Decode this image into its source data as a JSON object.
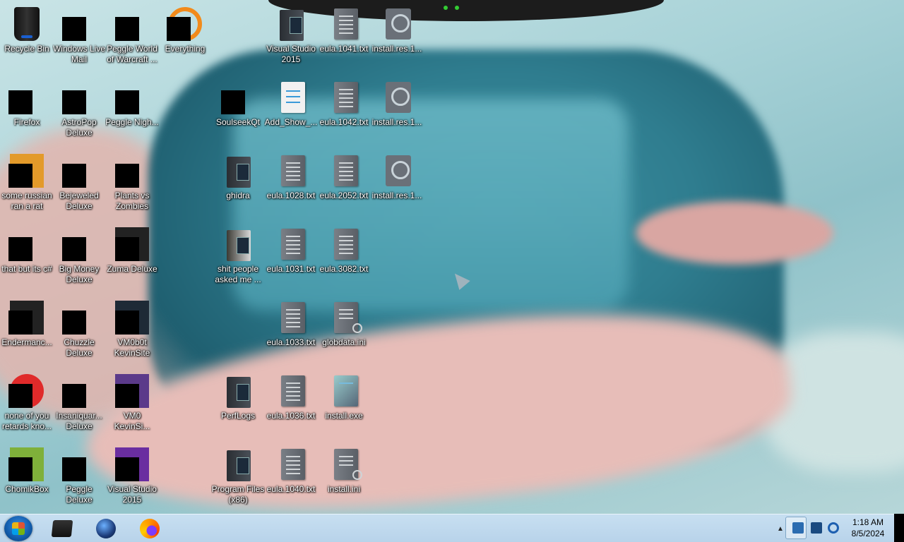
{
  "desktop": {
    "icons": [
      {
        "name": "recycle-bin",
        "label": "Recycle Bin"
      },
      {
        "name": "windows-live-mail",
        "label": "Windows Live Mail"
      },
      {
        "name": "peggle-world-of-warcraft",
        "label": "Peggle World of Warcraft ..."
      },
      {
        "name": "everything",
        "label": "Everything"
      },
      {
        "name": "firefox",
        "label": "Firefox"
      },
      {
        "name": "astropop-deluxe",
        "label": "AstroPop Deluxe"
      },
      {
        "name": "peggle-nights",
        "label": "Peggle Nigh..."
      },
      {
        "name": "soulseekqt",
        "label": "SoulseekQt"
      },
      {
        "name": "add-show",
        "label": "Add_Show_..."
      },
      {
        "name": "eula-1042",
        "label": "eula.1042.txt"
      },
      {
        "name": "install-res-2",
        "label": "install.res.1..."
      },
      {
        "name": "some-russian-ran-a-rat",
        "label": "some russian ran a rat"
      },
      {
        "name": "bejeweled-deluxe",
        "label": "Bejeweled Deluxe"
      },
      {
        "name": "plants-vs-zombies",
        "label": "Plants vs Zombies"
      },
      {
        "name": "ghidra",
        "label": "ghidra"
      },
      {
        "name": "eula-1028",
        "label": "eula.1028.txt"
      },
      {
        "name": "eula-2052",
        "label": "eula.2052.txt"
      },
      {
        "name": "install-res-3",
        "label": "install.res.1..."
      },
      {
        "name": "that-but-its-csharp",
        "label": "that but its c#"
      },
      {
        "name": "big-money-deluxe",
        "label": "Big Money Deluxe"
      },
      {
        "name": "zuma-deluxe",
        "label": "Zuma Deluxe"
      },
      {
        "name": "shit-people-asked-me",
        "label": "shit people asked me ..."
      },
      {
        "name": "eula-1031",
        "label": "eula.1031.txt"
      },
      {
        "name": "eula-3082",
        "label": "eula.3082.txt"
      },
      {
        "name": "endermanch",
        "label": "Endermanc..."
      },
      {
        "name": "chuzzle-deluxe",
        "label": "Chuzzle Deluxe"
      },
      {
        "name": "vm0b0t-kevinsite",
        "label": "VM0b0t KevinSite"
      },
      {
        "name": "eula-1033",
        "label": "eula.1033.txt"
      },
      {
        "name": "globdata-ini",
        "label": "globdata.ini"
      },
      {
        "name": "none-of-you-retards",
        "label": "none of you retards kno..."
      },
      {
        "name": "insaniquarium-deluxe",
        "label": "Insaniquar... Deluxe"
      },
      {
        "name": "vm0-kevinsi",
        "label": "VM0 KevinSi..."
      },
      {
        "name": "perflogs",
        "label": "PerfLogs"
      },
      {
        "name": "eula-1036",
        "label": "eula.1036.txt"
      },
      {
        "name": "install-exe",
        "label": "install.exe"
      },
      {
        "name": "chomikbox",
        "label": "ChomikBox"
      },
      {
        "name": "peggle-deluxe",
        "label": "Peggle Deluxe"
      },
      {
        "name": "visual-studio-2015-b",
        "label": "Visual Studio 2015"
      },
      {
        "name": "program-files-x86",
        "label": "Program Files (x86)"
      },
      {
        "name": "eula-1040",
        "label": "eula.1040.txt"
      },
      {
        "name": "install-ini",
        "label": "install.ini"
      },
      {
        "name": "visual-studio-2015-a",
        "label": "Visual Studio 2015"
      },
      {
        "name": "eula-1041",
        "label": "eula.1041.txt"
      },
      {
        "name": "install-res-1",
        "label": "install.res.1..."
      }
    ]
  },
  "taskbar": {
    "pinned": [
      "command-prompt",
      "globe-app",
      "firefox"
    ],
    "clock_time": "1:18 AM",
    "clock_date": "8/5/2024"
  },
  "colors": {
    "taskbar": "#b8d3ea",
    "start_orb": "#135fb0"
  }
}
